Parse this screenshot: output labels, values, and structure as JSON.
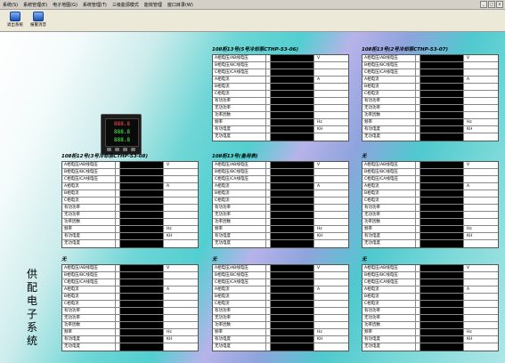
{
  "menubar": {
    "items": [
      "系统(S)",
      "系统管理(E)",
      "电子地图(G)",
      "系统管理(T)",
      "三级能源模式",
      "能效管理",
      "窗口目录(W)"
    ],
    "window_controls": [
      "_",
      "□",
      "×"
    ]
  },
  "toolbar": {
    "buttons": [
      {
        "label": "退出系统",
        "icon": "exit-icon"
      },
      {
        "label": "报警消音",
        "icon": "alarm-mute-icon"
      }
    ]
  },
  "meter": {
    "lines": [
      "888.8",
      "888.8",
      "888.8"
    ]
  },
  "vertical_title": [
    "供",
    "配",
    "电",
    "子",
    "系",
    "统"
  ],
  "row_labels": [
    "A相电压/AB线电压",
    "B相电压/BC线电压",
    "C相电压/CA线电压",
    "A相电流",
    "B相电流",
    "C相电流",
    "有功功率",
    "无功功率",
    "功率因数",
    "频率",
    "有功电度",
    "无功电度"
  ],
  "row_units": [
    "V",
    "",
    "",
    "A",
    "",
    "",
    "",
    "",
    "",
    "Hz",
    "KH",
    ""
  ],
  "panels": [
    {
      "title": "10Ⅱ柜13号(5号冷却泵CTHP-53-06)",
      "values": [
        "",
        "",
        "",
        "",
        "",
        "",
        "",
        "",
        "",
        "",
        "",
        ""
      ]
    },
    {
      "title": "10Ⅱ柜13号(2号冷却泵CTHP-53-07)",
      "values": [
        "",
        "",
        "",
        "",
        "",
        "",
        "",
        "",
        "",
        "",
        "",
        ""
      ]
    },
    {
      "title": "10Ⅱ柜12号(3号冷却泵CTHP-53-08)",
      "values": [
        "",
        "",
        "",
        "",
        "",
        "",
        "",
        "",
        "",
        "",
        "",
        ""
      ]
    },
    {
      "title": "10Ⅱ柜13号(备用表)",
      "values": [
        "",
        "",
        "",
        "",
        "",
        "",
        "",
        "",
        "",
        "",
        "",
        ""
      ]
    },
    {
      "title": "无",
      "values": [
        "",
        "",
        "",
        "",
        "",
        "",
        "",
        "",
        "",
        "",
        "",
        ""
      ]
    },
    {
      "title": "无",
      "values": [
        "",
        "",
        "",
        "",
        "",
        "",
        "",
        "",
        "",
        "",
        "",
        ""
      ]
    },
    {
      "title": "无",
      "values": [
        "",
        "",
        "",
        "",
        "",
        "",
        "",
        "",
        "",
        "",
        "",
        ""
      ]
    },
    {
      "title": "无",
      "values": [
        "",
        "",
        "",
        "",
        "",
        "",
        "",
        "",
        "",
        "",
        "",
        ""
      ]
    }
  ]
}
